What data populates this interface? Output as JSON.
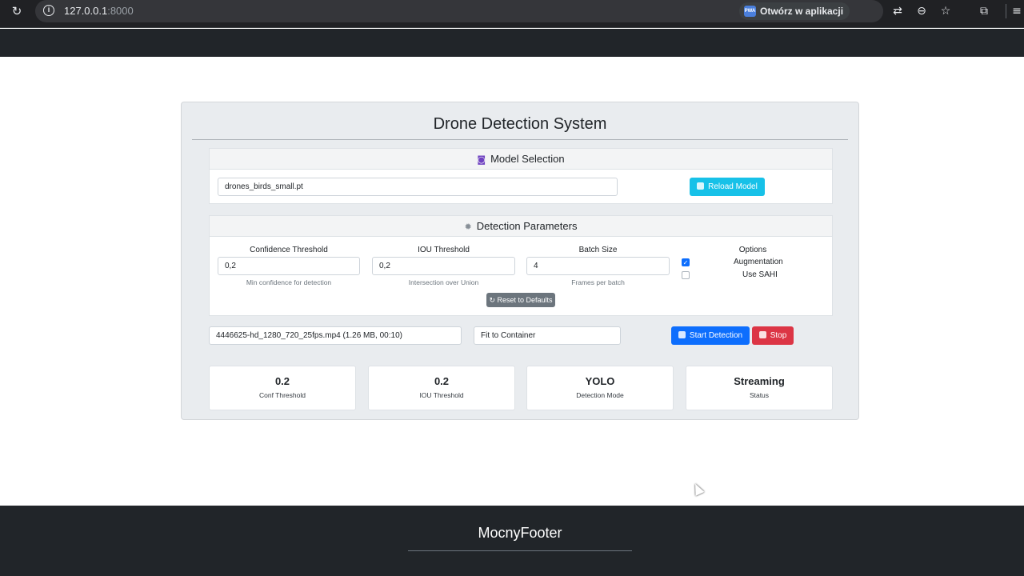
{
  "browser": {
    "url_host": "127.0.0.1",
    "url_port": ":8000",
    "open_in_app": "Otwórz w aplikacji",
    "pwa_badge": "PWA"
  },
  "page": {
    "title": "Drone Detection System",
    "footer_title": "MocnyFooter"
  },
  "model_panel": {
    "header": "Model Selection",
    "model_value": "drones_birds_small.pt",
    "reload_label": "Reload Model"
  },
  "params_panel": {
    "header": "Detection Parameters",
    "confidence": {
      "label": "Confidence Threshold",
      "value": "0,2",
      "help": "Min confidence for detection"
    },
    "iou": {
      "label": "IOU Threshold",
      "value": "0,2",
      "help": "Intersection over Union"
    },
    "batch": {
      "label": "Batch Size",
      "value": "4",
      "help": "Frames per batch"
    },
    "options": {
      "label": "Options",
      "augmentation": {
        "label": "Augmentation",
        "checked": true
      },
      "sahi": {
        "label": "Use SAHI",
        "checked": false
      }
    },
    "reset_label": "Reset to Defaults"
  },
  "controls": {
    "video_file": "4446625-hd_1280_720_25fps.mp4 (1.26 MB, 00:10)",
    "display_mode": "Fit to Container",
    "start_label": "Start Detection",
    "stop_label": "Stop"
  },
  "stats": [
    {
      "value": "0.2",
      "label": "Conf Threshold"
    },
    {
      "value": "0.2",
      "label": "IOU Threshold"
    },
    {
      "value": "YOLO",
      "label": "Detection Mode"
    },
    {
      "value": "Streaming",
      "label": "Status"
    }
  ],
  "colors": {
    "info": "#17c1e8",
    "primary": "#0d6efd",
    "danger": "#dc3545",
    "secondary": "#6c757d",
    "dark": "#212529"
  }
}
